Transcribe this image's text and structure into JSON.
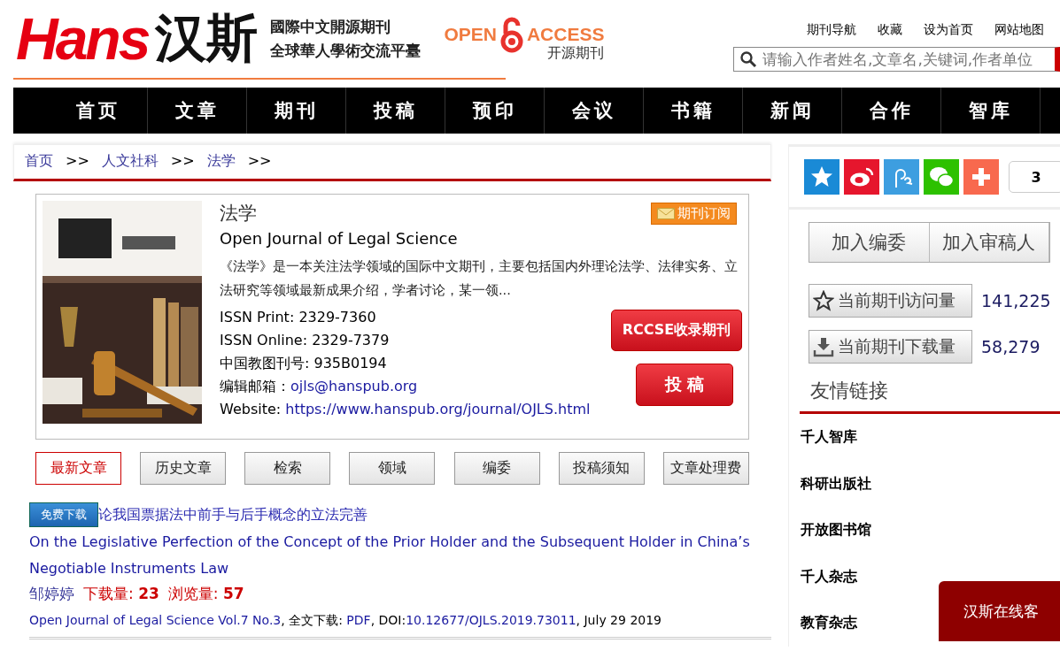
{
  "header": {
    "logo_latin": "Hans",
    "logo_cjk": "汉斯",
    "tagline": [
      "國際中文開源期刊",
      "全球華人學術交流平臺"
    ],
    "oa_left": "OPEN",
    "oa_right": "ACCESS",
    "oa_sub": "开源期刊",
    "top_links": [
      "期刊导航",
      "收藏",
      "设为首页",
      "网站地图"
    ],
    "search": {
      "placeholder": "请输入作者姓名,文章名,关键词,作者单位"
    }
  },
  "nav": [
    "首页",
    "文章",
    "期刊",
    "投稿",
    "预印",
    "会议",
    "书籍",
    "新闻",
    "合作",
    "智库"
  ],
  "breadcrumb": [
    {
      "label": "首页",
      "link": true
    },
    {
      "label": ">>",
      "link": false
    },
    {
      "label": "人文社科",
      "link": true
    },
    {
      "label": ">>",
      "link": false
    },
    {
      "label": "法学",
      "link": true
    },
    {
      "label": ">>",
      "link": false
    }
  ],
  "journal": {
    "title_cn": "法学",
    "title_en": "Open Journal of Legal Science",
    "subscribe": "期刊订阅",
    "description": "《法学》是一本关注法学领域的国际中文期刊，主要包括国内外理论法学、法律实务、立法研究等领域最新成果介绍，学者讨论，某一领...",
    "fields": [
      {
        "label": "ISSN Print: ",
        "value": "2329-7360",
        "kind": "text"
      },
      {
        "label": "ISSN Online: ",
        "value": "2329-7379",
        "kind": "text"
      },
      {
        "label": "中国教图刊号: ",
        "value": "935B0194",
        "kind": "text"
      },
      {
        "label": "编辑邮箱：",
        "value": "ojls@hanspub.org",
        "kind": "link"
      },
      {
        "label": "Website: ",
        "value": "https://www.hanspub.org/journal/OJLS.html",
        "kind": "link"
      }
    ],
    "rccse": "RCCSE收录期刊",
    "submit": "投 稿"
  },
  "tabs": [
    {
      "label": "最新文章",
      "selected": true
    },
    {
      "label": "历史文章",
      "selected": false
    },
    {
      "label": "检索",
      "selected": false
    },
    {
      "label": "领域",
      "selected": false
    },
    {
      "label": "编委",
      "selected": false
    },
    {
      "label": "投稿须知",
      "selected": false
    },
    {
      "label": "文章处理费",
      "selected": false
    }
  ],
  "article": {
    "free_download": "免费下载",
    "title_cn": "论我国票据法中前手与后手概念的立法完善",
    "title_en": "On the Legislative Perfection of the Concept of the Prior Holder and the Subsequent Holder in China’s Negotiable Instruments Law",
    "author": "邹婷婷",
    "downloads_label": "下载量: ",
    "downloads": "23",
    "views_label": "浏览量: ",
    "views": "57",
    "citation": [
      {
        "text": "Open Journal of Legal Science Vol.7 No.3",
        "link": true
      },
      {
        "text": ", 全文下载: ",
        "link": false
      },
      {
        "text": "PDF",
        "link": true
      },
      {
        "text": ", DOI:",
        "link": false
      },
      {
        "text": "10.12677/OJLS.2019.73011",
        "link": true
      },
      {
        "text": ", July 29 2019",
        "link": false
      }
    ]
  },
  "sidebar": {
    "share": [
      {
        "kind": "qzone",
        "color": "#1a8ad6"
      },
      {
        "kind": "weibo",
        "color": "#e6162d"
      },
      {
        "kind": "pengyou",
        "color": "#3d9ee0"
      },
      {
        "kind": "wechat",
        "color": "#2dc100"
      },
      {
        "kind": "more",
        "color": "#f8694e"
      }
    ],
    "share_count": "3",
    "join": [
      "加入编委",
      "加入审稿人"
    ],
    "stats": [
      {
        "kind": "visits",
        "label": "当前期刊访问量",
        "value": "141,225"
      },
      {
        "kind": "downloads",
        "label": "当前期刊下载量",
        "value": "58,279"
      }
    ],
    "links_title": "友情链接",
    "links": [
      "千人智库",
      "科研出版社",
      "开放图书馆",
      "千人杂志",
      "教育杂志"
    ]
  },
  "chat_button": "汉斯在线客"
}
